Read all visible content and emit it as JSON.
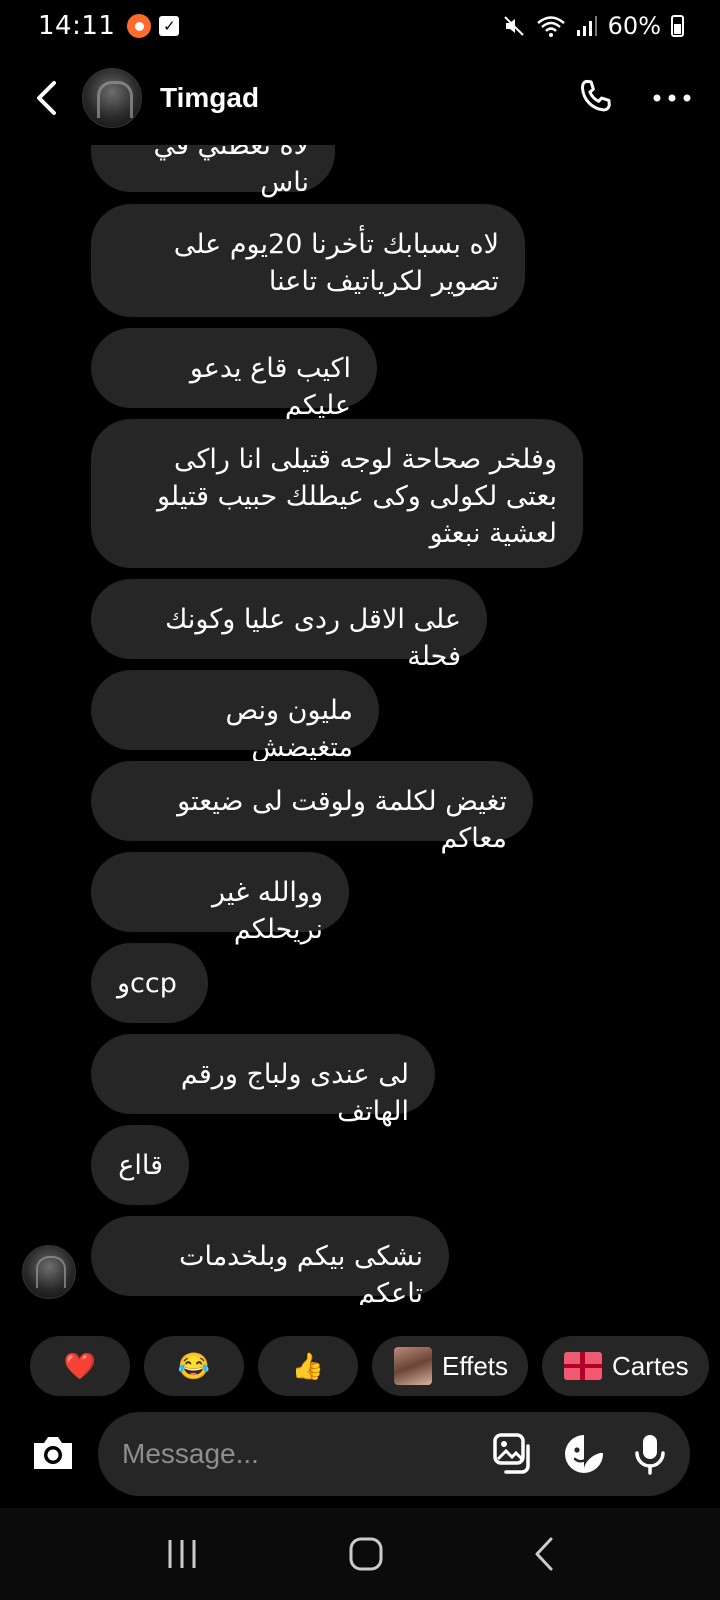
{
  "status_bar": {
    "time": "14:11",
    "battery": "60%"
  },
  "header": {
    "contact_name": "Timgad"
  },
  "messages": [
    {
      "text": "لاه تعطني في ناس",
      "sender": "me"
    },
    {
      "text": "لاه بسبابك تأخرنا 20يوم على تصوير لكرياتيف تاعنا",
      "sender": "me"
    },
    {
      "text": "اكيب قاع يدعو عليكم",
      "sender": "me"
    },
    {
      "text": "وفلخر صحاحة لوجه قتيلى انا راكى بعتى لكولى وكى عيطلك حبيب قتيلو لعشية نبعثو",
      "sender": "me"
    },
    {
      "text": "على الاقل ردى عليا وكونك فحلة",
      "sender": "me"
    },
    {
      "text": "مليون ونص متغيضش",
      "sender": "me"
    },
    {
      "text": "تغيض لكلمة ولوقت لى ضيعتو معاكم",
      "sender": "me"
    },
    {
      "text": "ووالله غير نريحلكم",
      "sender": "me"
    },
    {
      "text": "وccp",
      "sender": "me"
    },
    {
      "text": "لى عندى ولباج ورقم الهاتف",
      "sender": "me"
    },
    {
      "text": "قااع",
      "sender": "me"
    },
    {
      "text": "نشكى بيكم وبلخدمات تاعكم",
      "sender": "me"
    }
  ],
  "quick_reactions": {
    "heart": "❤️",
    "laugh": "😂",
    "thumbs_up": "👍",
    "effects_label": "Effets",
    "cards_label": "Cartes"
  },
  "composer": {
    "placeholder": "Message..."
  },
  "colors": {
    "background": "#000000",
    "bubble": "#262626",
    "text": "#ffffff",
    "placeholder": "#8e8e8e"
  }
}
